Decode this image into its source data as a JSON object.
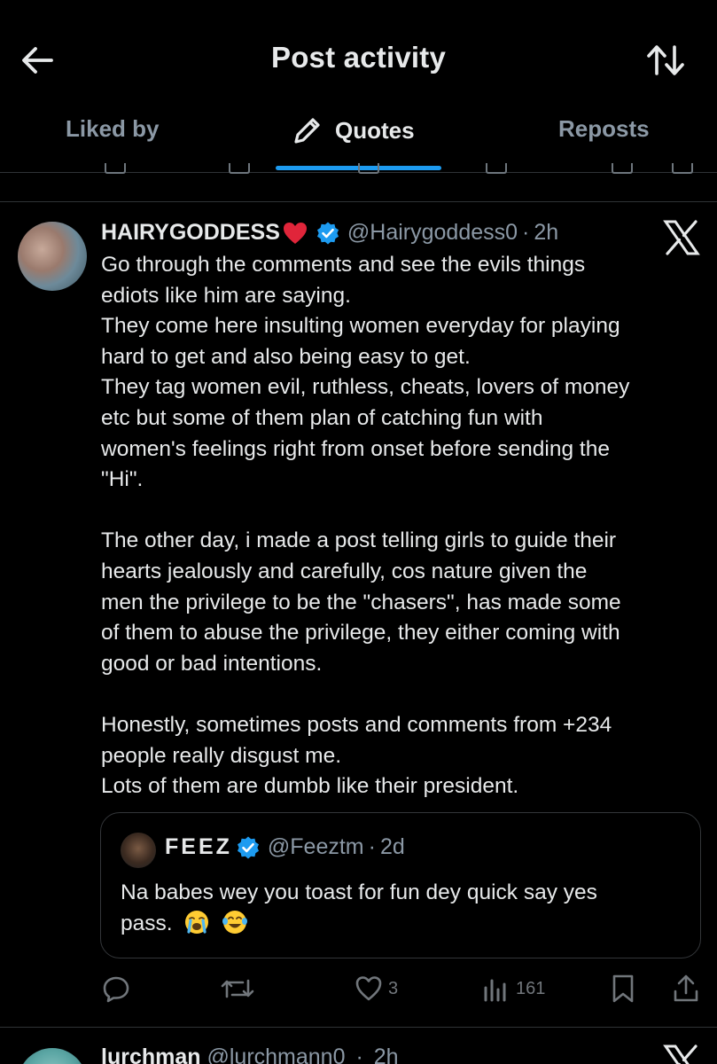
{
  "header": {
    "title": "Post activity",
    "back_icon": "arrow-left-icon",
    "sort_icon": "sort-arrows-icon"
  },
  "tabs": [
    {
      "label": "Liked by",
      "active": false
    },
    {
      "label": "Quotes",
      "active": true,
      "icon": "pencil-icon"
    },
    {
      "label": "Reposts",
      "active": false
    }
  ],
  "post": {
    "display_name": "HAIRYGODDESS",
    "name_emoji": "red-heart",
    "handle": "@Hairygoddess0",
    "separator": "·",
    "time": "2h",
    "verified": true,
    "paragraphs": [
      [
        "Go through the comments and see the evils things",
        "ediots like him are saying.",
        "They come here insulting women everyday for playing",
        "hard to get and also being easy to get.",
        "They tag women evil, ruthless, cheats, lovers of money",
        "etc but some of them plan of catching fun with",
        "women's feelings  right from onset before sending the",
        "\"Hi\"."
      ],
      [
        "The other day, i made a post telling girls to guide their",
        "hearts jealously and carefully, cos nature given the",
        "men the privilege to be the \"chasers\", has made some",
        "of them to abuse the privilege,  they either coming with",
        "good  or bad intentions."
      ],
      [
        "Honestly, sometimes posts and comments from +234",
        "people really disgust me.",
        "Lots of them are dumbb like their president."
      ]
    ],
    "quote": {
      "display_name": "FEEZ",
      "handle": "@Feeztm",
      "separator": "·",
      "time": "2d",
      "verified": true,
      "text_lines": [
        "Na babes wey you toast for fun dey quick say yes",
        "pass."
      ],
      "emojis": [
        "loudly-crying-face",
        "face-with-tears-of-joy"
      ]
    },
    "actions": {
      "likes": "3",
      "views": "161"
    }
  },
  "next_post": {
    "display_name": "lurchman",
    "handle": "@lurchmann0",
    "separator": "·",
    "time": "2h"
  },
  "colors": {
    "background": "#000000",
    "text": "#e7e9ea",
    "muted": "#8b98a5",
    "accent": "#1d9bf0",
    "border": "#2f3336"
  }
}
